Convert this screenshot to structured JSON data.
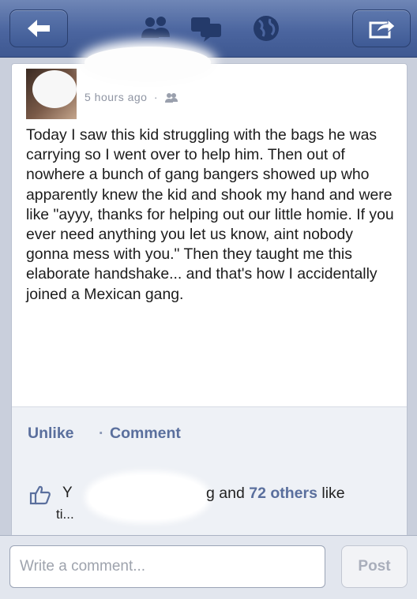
{
  "nav": {
    "icons": [
      "back-arrow-icon",
      "friend-requests-icon",
      "messages-icon",
      "notifications-globe-icon",
      "share-icon"
    ]
  },
  "post": {
    "meta_time": "5 hours ago",
    "meta_separator": "·",
    "audience_icon": "friends-icon",
    "text": "Today I saw this kid struggling with the bags he was carrying so I went over to help him. Then out of nowhere a bunch of gang bangers showed up who apparently knew the kid and shook my hand and were like \"ayyy, thanks for helping out our little homie. If you ever need anything you let us know, aint nobody gonna mess with you.\" Then they taught me this elaborate handshake... and that's how I accidentally joined a Mexican gang."
  },
  "actions": {
    "unlike": "Unlike",
    "separator": "·",
    "comment": "Comment"
  },
  "likes": {
    "prefix_visible": "Y",
    "suffix_visible": "ti...",
    "text_visible": "g and",
    "count": "72 others",
    "suffix": "like"
  },
  "composer": {
    "placeholder": "Write a comment...",
    "post_label": "Post"
  },
  "colors": {
    "nav_bar": "#4b659f",
    "link_blue": "#5a6f9d",
    "card_bg": "#ffffff",
    "footer_bg": "#eef1f6"
  }
}
